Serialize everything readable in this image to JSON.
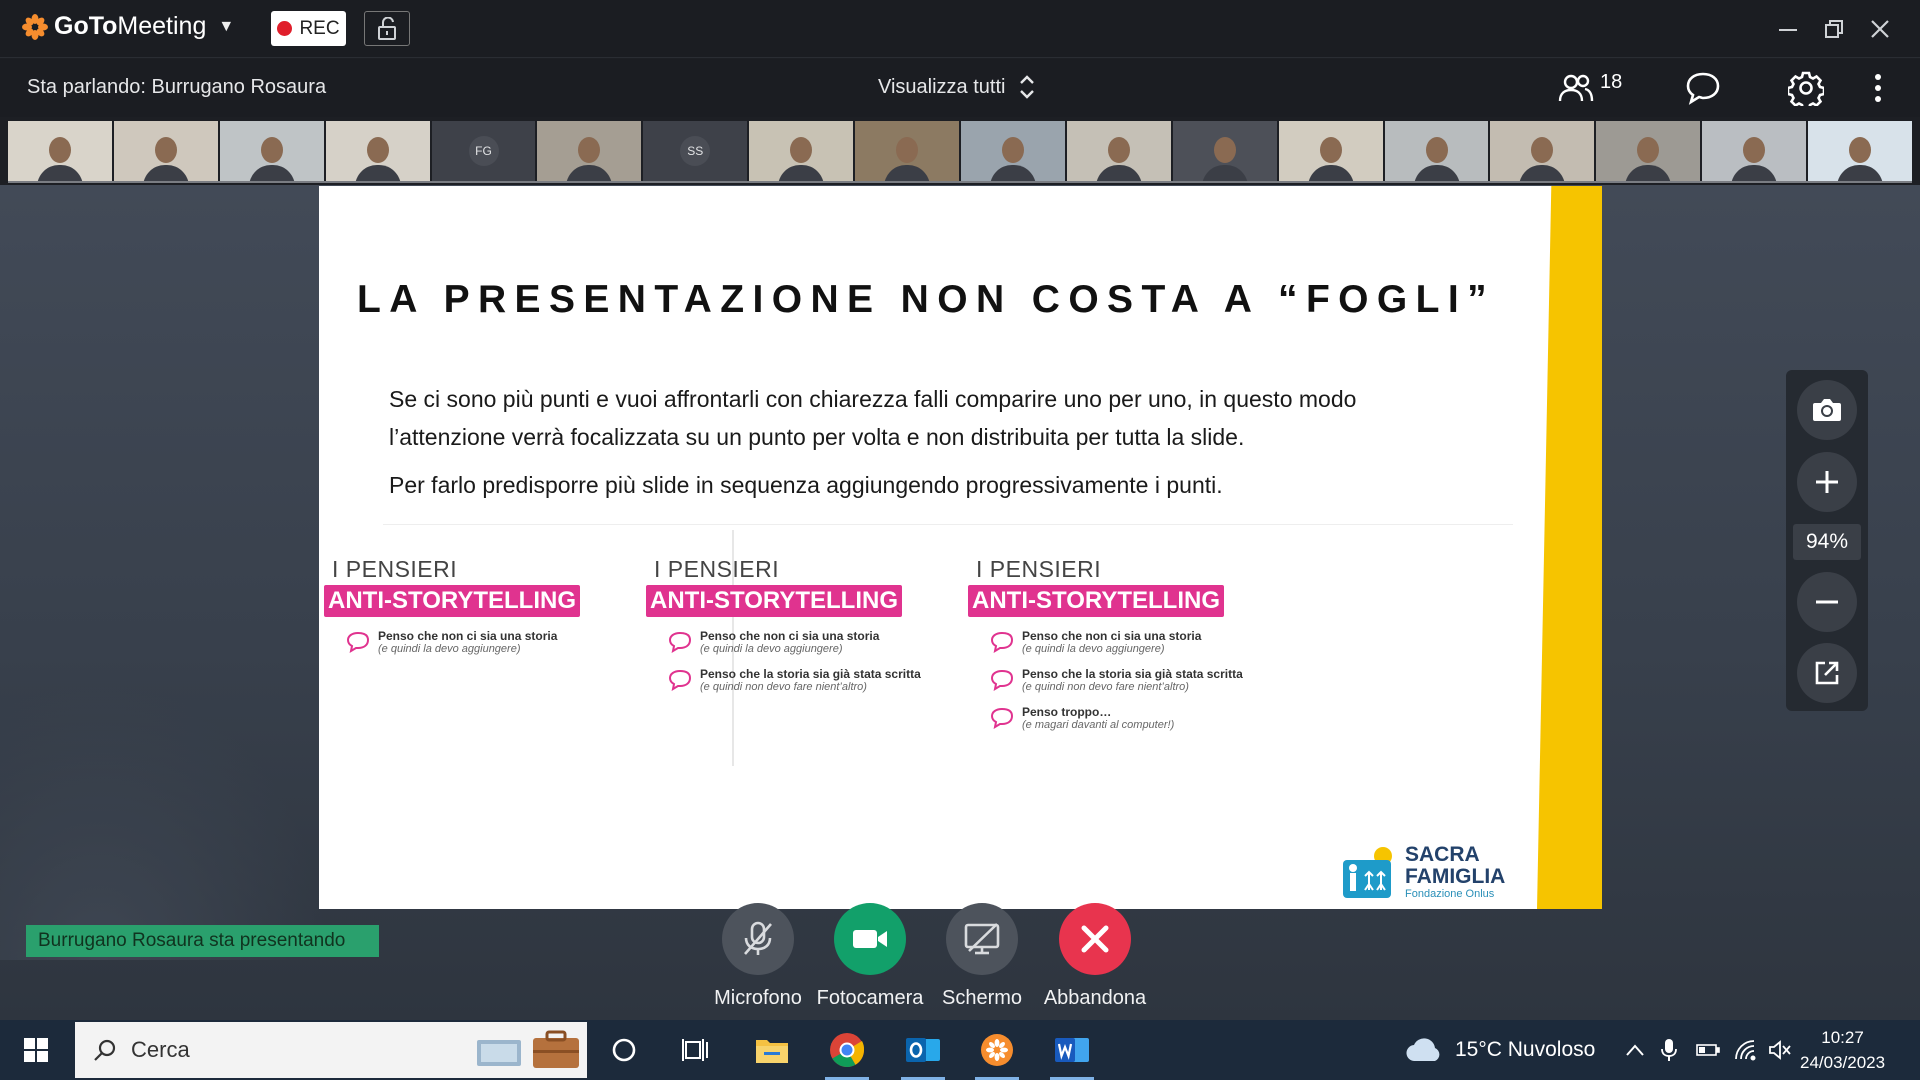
{
  "app": {
    "name_goto": "GoTo",
    "name_meeting": "Meeting",
    "rec_label": "REC"
  },
  "toolbar": {
    "speaking": "Sta parlando: Burrugano Rosaura",
    "view_all": "Visualizza tutti",
    "attendee_count": "18"
  },
  "thumbnails": [
    {
      "initials": ""
    },
    {
      "initials": ""
    },
    {
      "initials": ""
    },
    {
      "initials": ""
    },
    {
      "initials": "FG"
    },
    {
      "initials": ""
    },
    {
      "initials": "SS"
    },
    {
      "initials": ""
    },
    {
      "initials": ""
    },
    {
      "initials": ""
    },
    {
      "initials": ""
    },
    {
      "initials": ""
    },
    {
      "initials": ""
    },
    {
      "initials": ""
    },
    {
      "initials": ""
    },
    {
      "initials": ""
    },
    {
      "initials": ""
    },
    {
      "initials": ""
    }
  ],
  "slide": {
    "title": "LA PRESENTAZIONE NON COSTA A “FOGLI”",
    "p1": "Se ci sono più punti e vuoi affrontarli con chiarezza falli comparire uno per uno, in questo modo l’attenzione verrà focalizzata su un punto per volta e non distribuita per tutta la slide.",
    "p2": "Per farlo predisporre più slide in sequenza aggiungendo progressivamente i punti.",
    "col_heading_1": "I PENSIERI",
    "col_heading_2": "ANTI-STORYTELLING",
    "items": [
      {
        "t1": "Penso che non ci sia una storia",
        "t2": "(e quindi la devo aggiungere)"
      },
      {
        "t1": "Penso che la storia sia già stata scritta",
        "t2": "(e quindi non devo fare nient’altro)"
      },
      {
        "t1": "Penso troppo…",
        "t2": "(e magari davanti al computer!)"
      }
    ],
    "logo": {
      "line1": "SACRA",
      "line2": "FAMIGLIA",
      "line3": "Fondazione Onlus"
    }
  },
  "zoom": {
    "percent": "94%"
  },
  "presenter_badge": "Burrugano Rosaura sta presentando",
  "controls": {
    "mic": "Microfono",
    "camera": "Fotocamera",
    "screen": "Schermo",
    "leave": "Abbandona"
  },
  "colors": {
    "camera": "#12a06a",
    "leave": "#e8344e",
    "gray": "#4d535c",
    "accent_pink": "#e0338f",
    "accent_yellow": "#f6c400"
  },
  "taskbar": {
    "search_placeholder": "Cerca",
    "weather": "15°C  Nuvoloso",
    "time": "10:27",
    "date": "24/03/2023"
  }
}
